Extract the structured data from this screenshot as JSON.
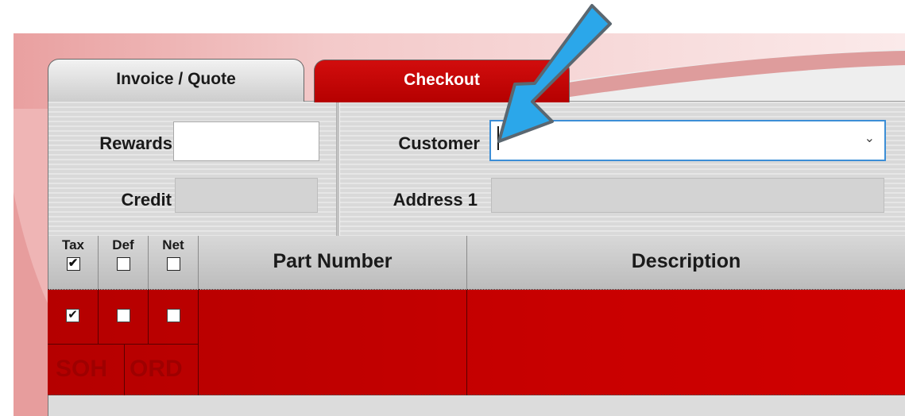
{
  "tabs": [
    {
      "label": "Invoice / Quote",
      "active": true
    },
    {
      "label": "Checkout",
      "active": false
    }
  ],
  "fields": {
    "rewards": {
      "label": "Rewards",
      "value": ""
    },
    "credit": {
      "label": "Credit",
      "value": ""
    },
    "customer": {
      "label": "Customer",
      "value": ""
    },
    "address1": {
      "label": "Address 1",
      "value": ""
    }
  },
  "grid": {
    "headers": {
      "tax": {
        "label": "Tax",
        "checked": true
      },
      "def": {
        "label": "Def",
        "checked": false
      },
      "net": {
        "label": "Net",
        "checked": false
      },
      "part_number": "Part Number",
      "description": "Description"
    },
    "row": {
      "tax_checked": true,
      "def_checked": false,
      "net_checked": false,
      "soh_label": "SOH",
      "ord_label": "ORD"
    }
  },
  "colors": {
    "accent_red": "#c00000",
    "annotation_arrow": "#2ba7ea",
    "focus_border": "#3c8ed6"
  },
  "icons": {
    "dropdown": "chevron-down-icon",
    "annotation": "arrow-pointer-icon"
  }
}
